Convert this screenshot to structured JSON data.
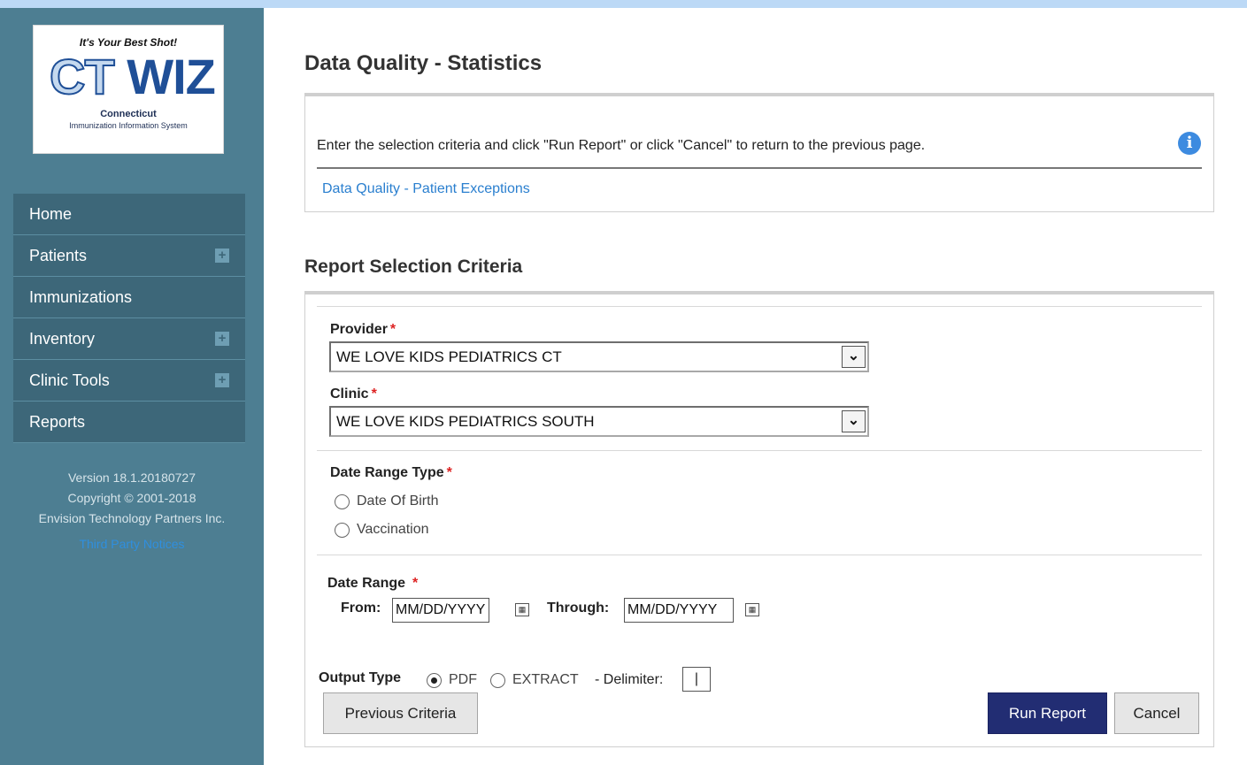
{
  "logo": {
    "tagline": "It's Your Best Shot!",
    "brand_ct": "CT",
    "brand_wiz": "WIZ",
    "state": "Connecticut",
    "system": "Immunization Information System"
  },
  "nav": {
    "items": [
      {
        "label": "Home",
        "expandable": false
      },
      {
        "label": "Patients",
        "expandable": true
      },
      {
        "label": "Immunizations",
        "expandable": false
      },
      {
        "label": "Inventory",
        "expandable": true
      },
      {
        "label": "Clinic Tools",
        "expandable": true
      },
      {
        "label": "Reports",
        "expandable": false
      }
    ],
    "expand_glyph": "+"
  },
  "footer": {
    "version": "Version 18.1.20180727",
    "copyright": "Copyright © 2001-2018",
    "company": "Envision Technology Partners Inc.",
    "notices": "Third Party Notices"
  },
  "page": {
    "title": "Data Quality - Statistics",
    "instructions": "Enter the selection criteria and click \"Run Report\" or click \"Cancel\" to return to the previous page.",
    "info_glyph": "i",
    "related_link": "Data Quality - Patient Exceptions"
  },
  "criteria": {
    "heading": "Report Selection Criteria",
    "required_mark": "*",
    "provider_label": "Provider",
    "provider_value": "WE LOVE KIDS PEDIATRICS CT",
    "clinic_label": "Clinic",
    "clinic_value": "WE LOVE KIDS PEDIATRICS SOUTH",
    "date_range_type_label": "Date Range Type",
    "date_range_type_options": [
      "Date Of Birth",
      "Vaccination"
    ],
    "date_range_label": "Date Range",
    "from_label": "From:",
    "from_value": "MM/DD/YYYY",
    "through_label": "Through:",
    "through_value": "MM/DD/YYYY",
    "output_type_label": "Output Type",
    "output_options": [
      "PDF",
      "EXTRACT"
    ],
    "output_selected": "PDF",
    "delimiter_label": "- Delimiter:",
    "delimiter_value": "|"
  },
  "buttons": {
    "previous": "Previous Criteria",
    "run": "Run Report",
    "cancel": "Cancel"
  },
  "colors": {
    "sidebar": "#4d7e92",
    "nav_item": "#3d6779",
    "primary_button": "#222d73",
    "link": "#2a7fcf",
    "required": "#dd2222"
  }
}
